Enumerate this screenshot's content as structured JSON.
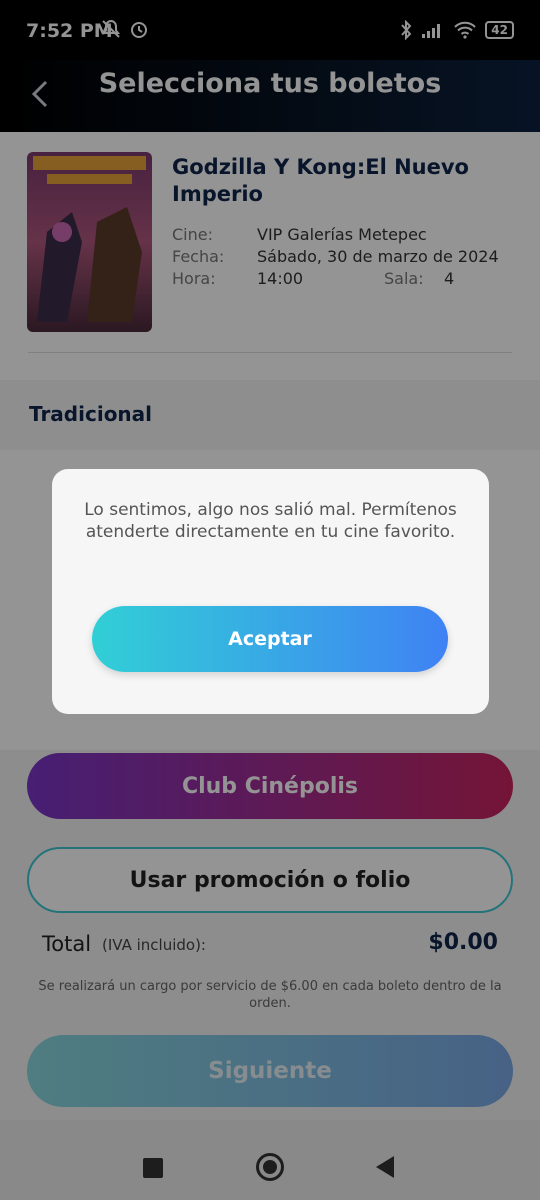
{
  "status_bar": {
    "time": "7:52 PM",
    "battery": "42"
  },
  "header": {
    "title": "Selecciona tus boletos"
  },
  "movie": {
    "title": "Godzilla Y Kong:El Nuevo Imperio",
    "cine_label": "Cine:",
    "cine_value": "VIP Galerías Metepec",
    "fecha_label": "Fecha:",
    "fecha_value": "Sábado, 30 de marzo de 2024",
    "hora_label": "Hora:",
    "hora_value": "14:00",
    "sala_label": "Sala:",
    "sala_value": "4"
  },
  "section": {
    "title": "Tradicional"
  },
  "buttons": {
    "club": "Club Cinépolis",
    "promo": "Usar promoción o folio",
    "next": "Siguiente"
  },
  "total": {
    "label": "Total",
    "sub": "(IVA incluido):",
    "value": "$0.00",
    "note": "Se realizará un cargo por servicio de $6.00 en cada boleto dentro de la orden."
  },
  "dialog": {
    "message": "Lo sentimos, algo nos salió mal. Permítenos atenderte directamente en tu cine favorito.",
    "accept": "Aceptar"
  },
  "colors": {
    "accent_navy": "#10254a",
    "club_gradient": [
      "#7a36c8",
      "#c8245f"
    ],
    "accept_gradient": [
      "#31cfd6",
      "#3f82f4"
    ]
  }
}
